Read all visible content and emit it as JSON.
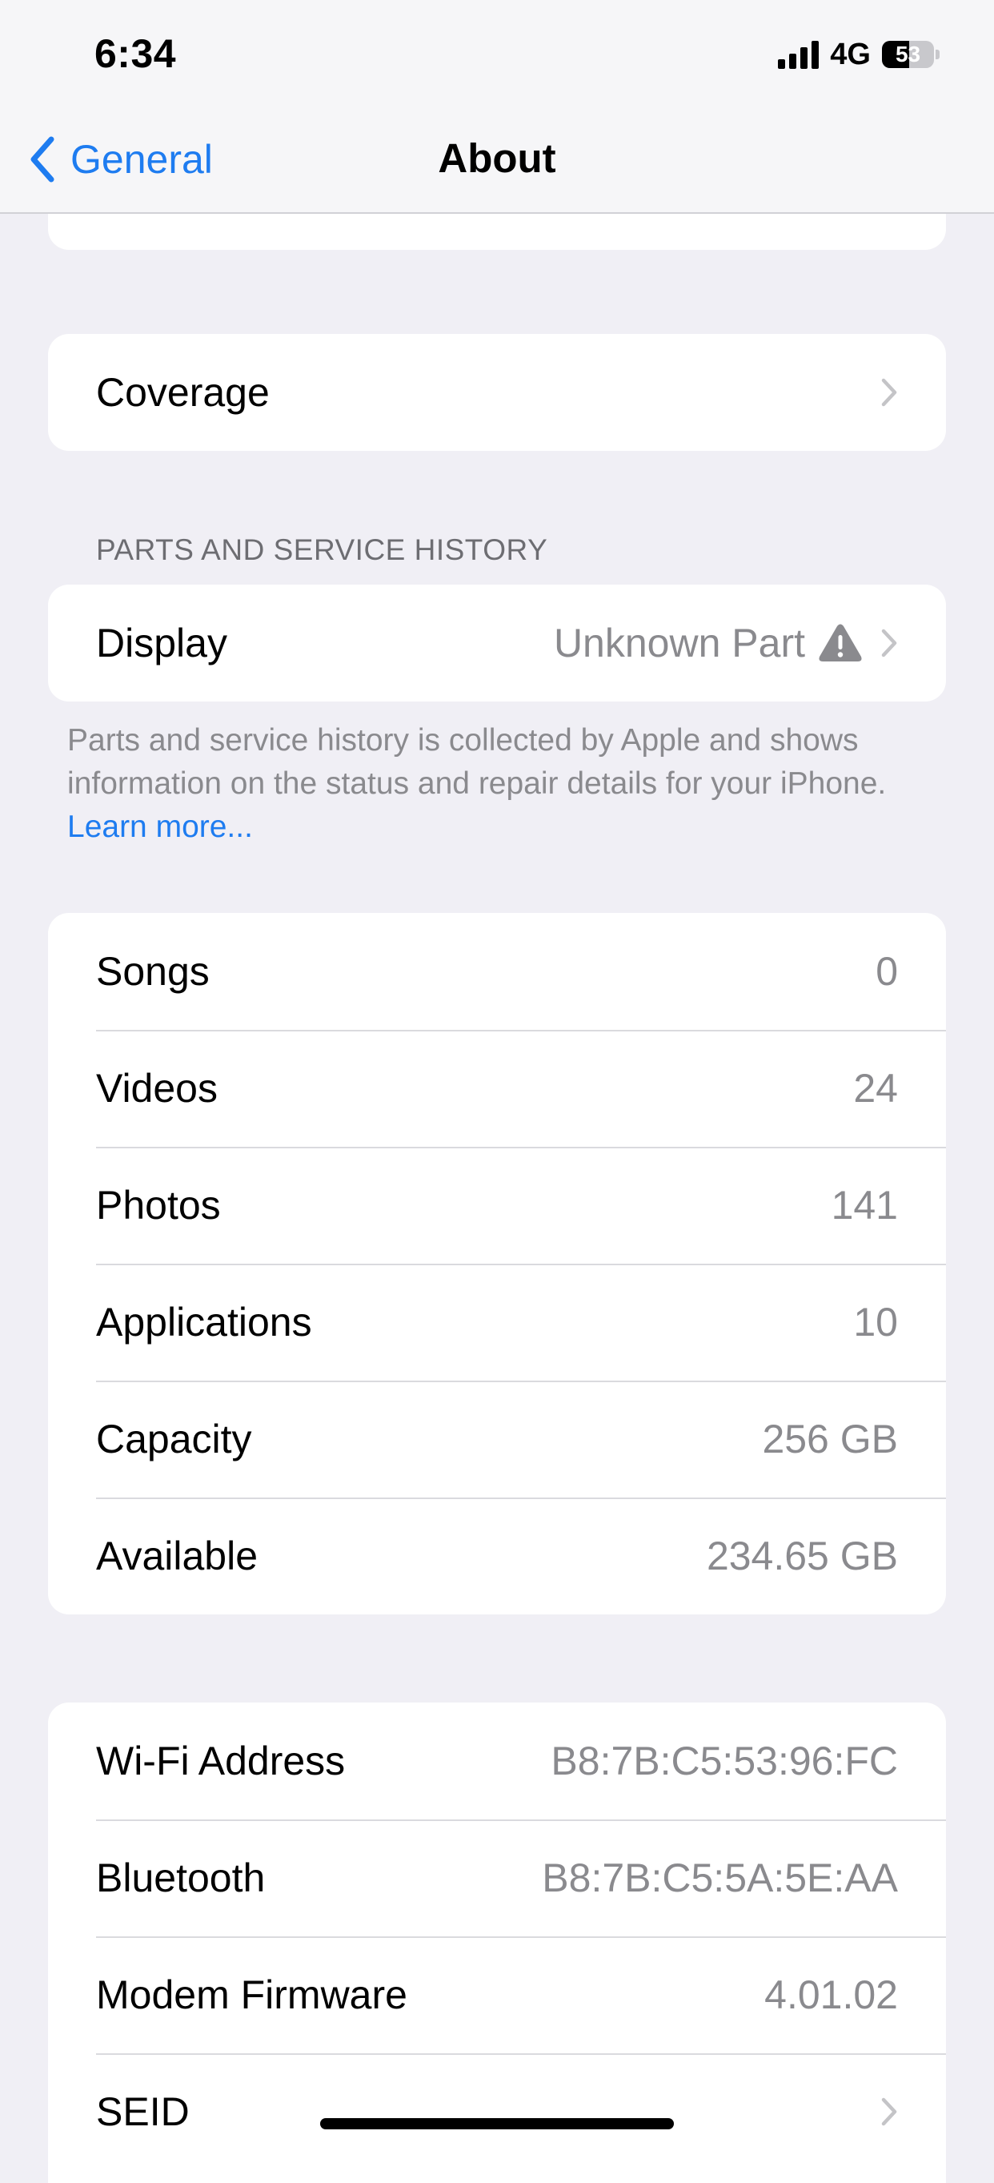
{
  "status_bar": {
    "time": "6:34",
    "network": "4G",
    "battery_level": "53",
    "battery_fraction": 0.53
  },
  "nav": {
    "back_label": "General",
    "title": "About"
  },
  "coverage": {
    "label": "Coverage"
  },
  "parts": {
    "header": "PARTS AND SERVICE HISTORY",
    "display_label": "Display",
    "display_value": "Unknown Part",
    "footnote_text": "Parts and service history is collected by Apple and shows information on the status and repair details for your iPhone.",
    "learn_more": "Learn more..."
  },
  "media": [
    {
      "label": "Songs",
      "value": "0"
    },
    {
      "label": "Videos",
      "value": "24"
    },
    {
      "label": "Photos",
      "value": "141"
    },
    {
      "label": "Applications",
      "value": "10"
    },
    {
      "label": "Capacity",
      "value": "256 GB"
    },
    {
      "label": "Available",
      "value": "234.65 GB"
    }
  ],
  "network_info": [
    {
      "label": "Wi-Fi Address",
      "value": "B8:7B:C5:53:96:FC"
    },
    {
      "label": "Bluetooth",
      "value": "B8:7B:C5:5A:5E:AA"
    },
    {
      "label": "Modem Firmware",
      "value": "4.01.02"
    },
    {
      "label": "SEID",
      "value": ""
    }
  ],
  "colors": {
    "accent": "#1E7CF0",
    "background": "#F0EFF5",
    "secondary_text": "#8A8A8E"
  },
  "icons": {
    "back": "chevron-left-icon",
    "row_arrow": "chevron-right-icon",
    "warning": "warning-triangle-icon"
  }
}
